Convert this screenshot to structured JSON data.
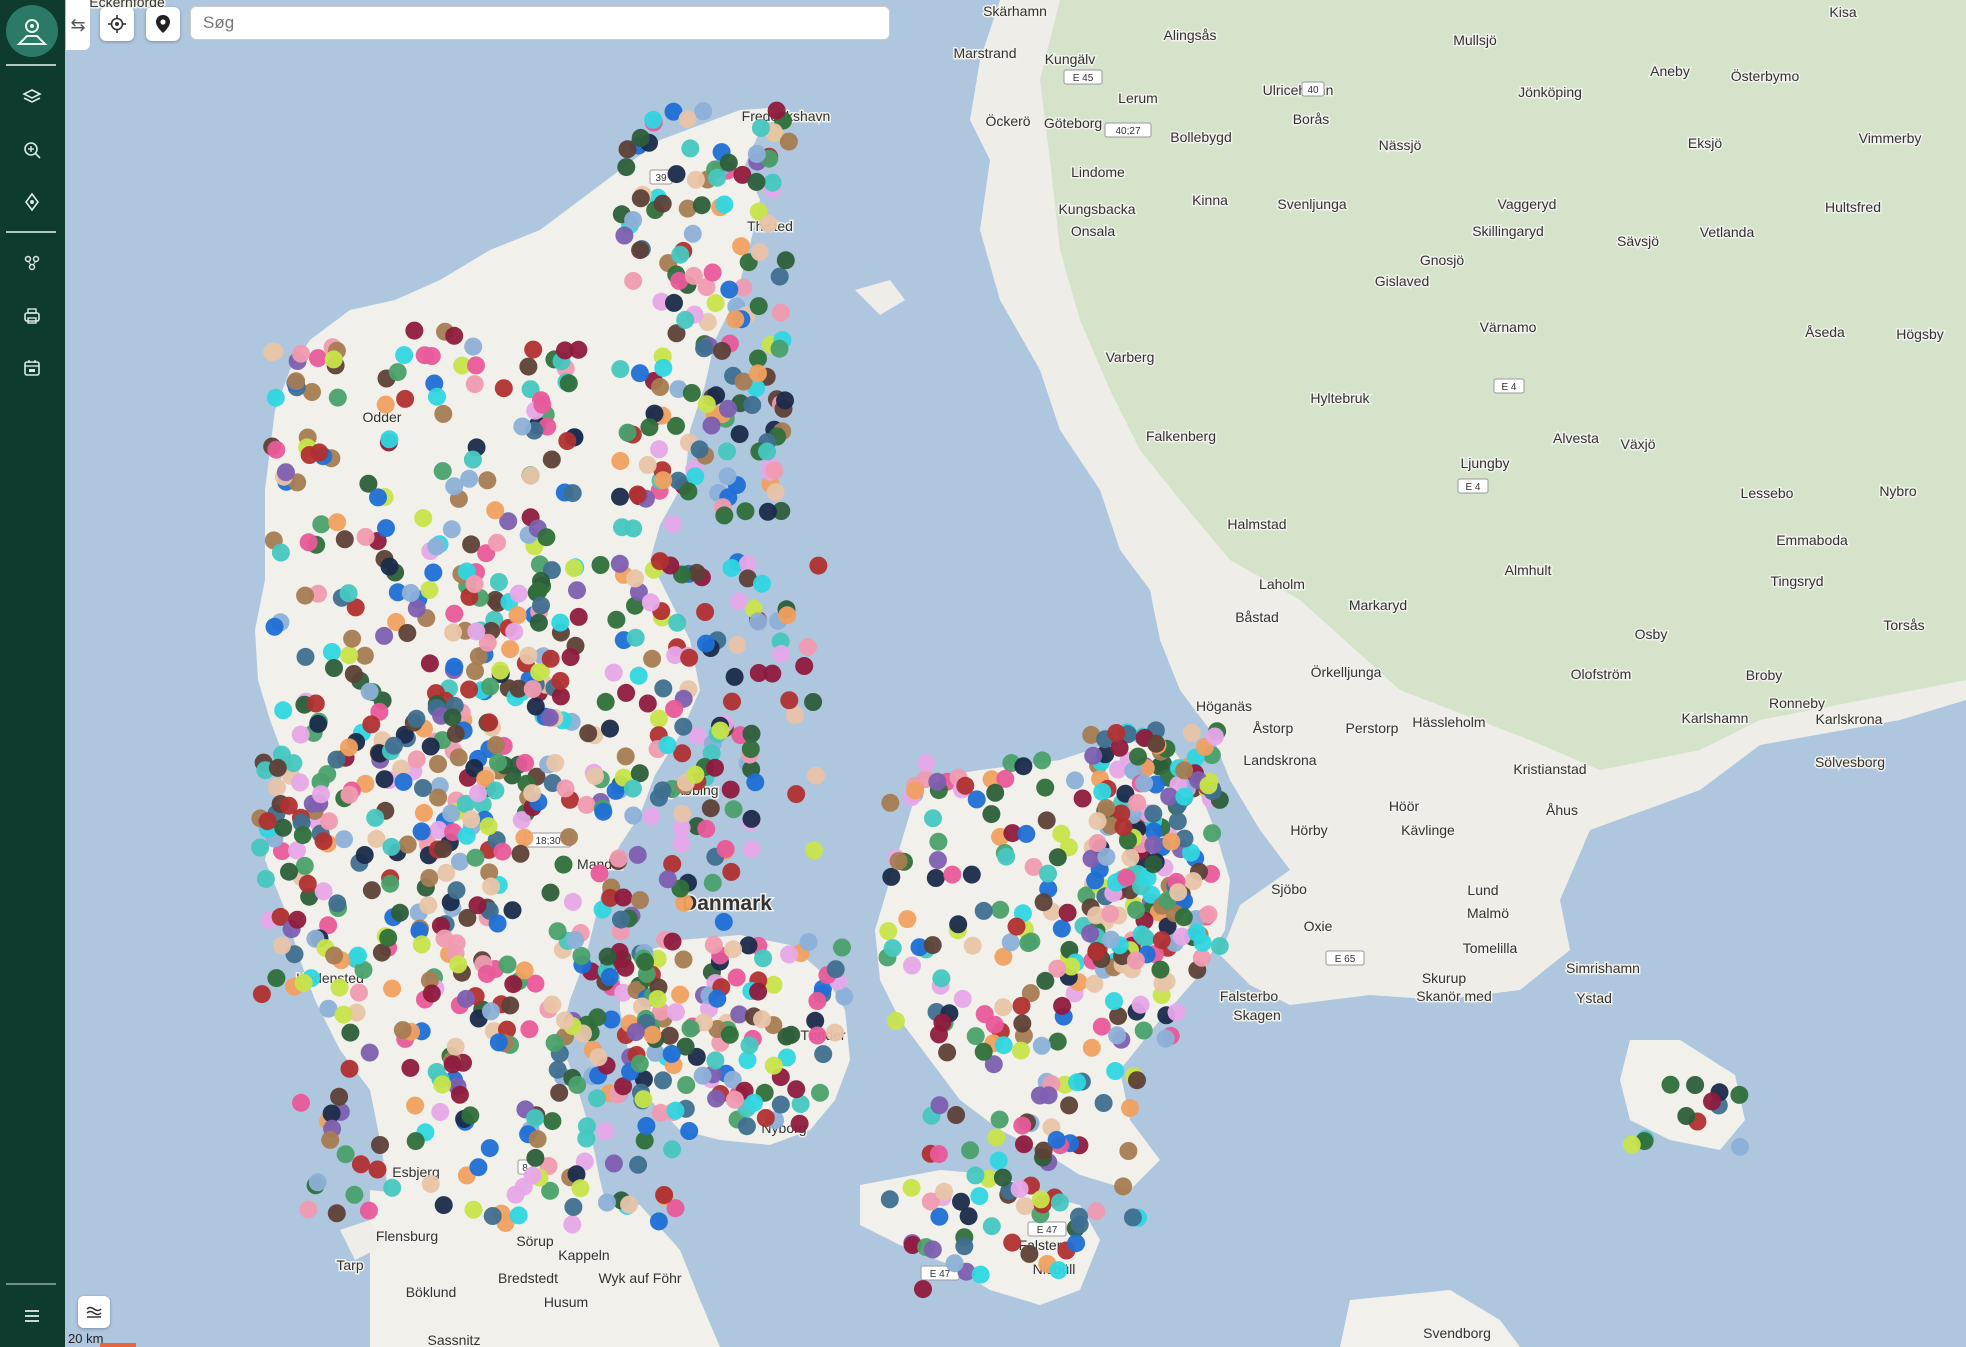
{
  "sidebar": {
    "items": [
      {
        "icon": "layers-icon",
        "label": "Lag"
      },
      {
        "icon": "zoom-search-icon",
        "label": "Find"
      },
      {
        "icon": "route-icon",
        "label": "Rute"
      },
      {
        "icon": "cluster-icon",
        "label": "Grupper"
      },
      {
        "icon": "printer-icon",
        "label": "Print"
      },
      {
        "icon": "calendar-icon",
        "label": "Kalender"
      }
    ],
    "menu_icon": "hamburger-menu-icon"
  },
  "toolbar": {
    "collapse_icon": "swap-arrows-icon",
    "locate_icon": "crosshair-icon",
    "pin_icon": "map-pin-icon"
  },
  "search": {
    "placeholder": "Søg",
    "value": ""
  },
  "map": {
    "scale_label": "20 km",
    "country_label": "Danmark",
    "place_labels": [
      "Skärhamn",
      "Marstrand",
      "Kungälv",
      "Alingsås",
      "Mullsjö",
      "Jönköping",
      "Aneby",
      "Österbymo",
      "Kisa",
      "Öckerö",
      "Göteborg",
      "Lerum",
      "Ulricehamn",
      "Borås",
      "Bollebygd",
      "Nässjö",
      "Eksjö",
      "Vimmerby",
      "Lindome",
      "Kungsbacka",
      "Onsala",
      "Kinna",
      "Svenljunga",
      "Vaggeryd",
      "Skillingaryd",
      "Sävsjö",
      "Vetlanda",
      "Hultsfred",
      "Gnosjö",
      "Gislaved",
      "Värnamo",
      "Åseda",
      "Högsby",
      "Varberg",
      "Hyltebruk",
      "Falkenberg",
      "Alvesta",
      "Växjö",
      "Ljungby",
      "Lessebo",
      "Nybro",
      "Emmaboda",
      "Halmstad",
      "Laholm",
      "Markaryd",
      "Tingsryd",
      "Almhult",
      "Båstad",
      "Osby",
      "Torsås",
      "Örkelljunga",
      "Broby",
      "Olofström",
      "Höganäs",
      "Åstorp",
      "Perstorp",
      "Hässleholm",
      "Karlshamn",
      "Ronneby",
      "Karlskrona",
      "Kristianstad",
      "Sölvesborg",
      "Landskrona",
      "Höör",
      "Åhus",
      "Hörby",
      "Kävlinge",
      "Lund",
      "Sjöbo",
      "Malmö",
      "Oxie",
      "Tomelilla",
      "Simrishamn",
      "Skurup",
      "Ystad",
      "Skanör med",
      "Falsterbo",
      "Skagen",
      "Frederikshavn",
      "Thisted",
      "Odder",
      "Nykøbing",
      "Falster",
      "Niebüll",
      "Flensburg",
      "Sörup",
      "Kappeln",
      "Wyk auf Föhr",
      "Tarp",
      "Bredstedt",
      "Böklund",
      "Husum",
      "Sassnitz",
      "Svendborg",
      "Nyborg",
      "Tønder",
      "Esbjerg",
      "Hedensted",
      "Mandal",
      "Eckernförde"
    ],
    "road_labels": [
      "E 45",
      "40",
      "40;27",
      "E 4",
      "E 4",
      "E 65",
      "E 47",
      "E 47",
      "18;30",
      "39",
      "8"
    ]
  }
}
